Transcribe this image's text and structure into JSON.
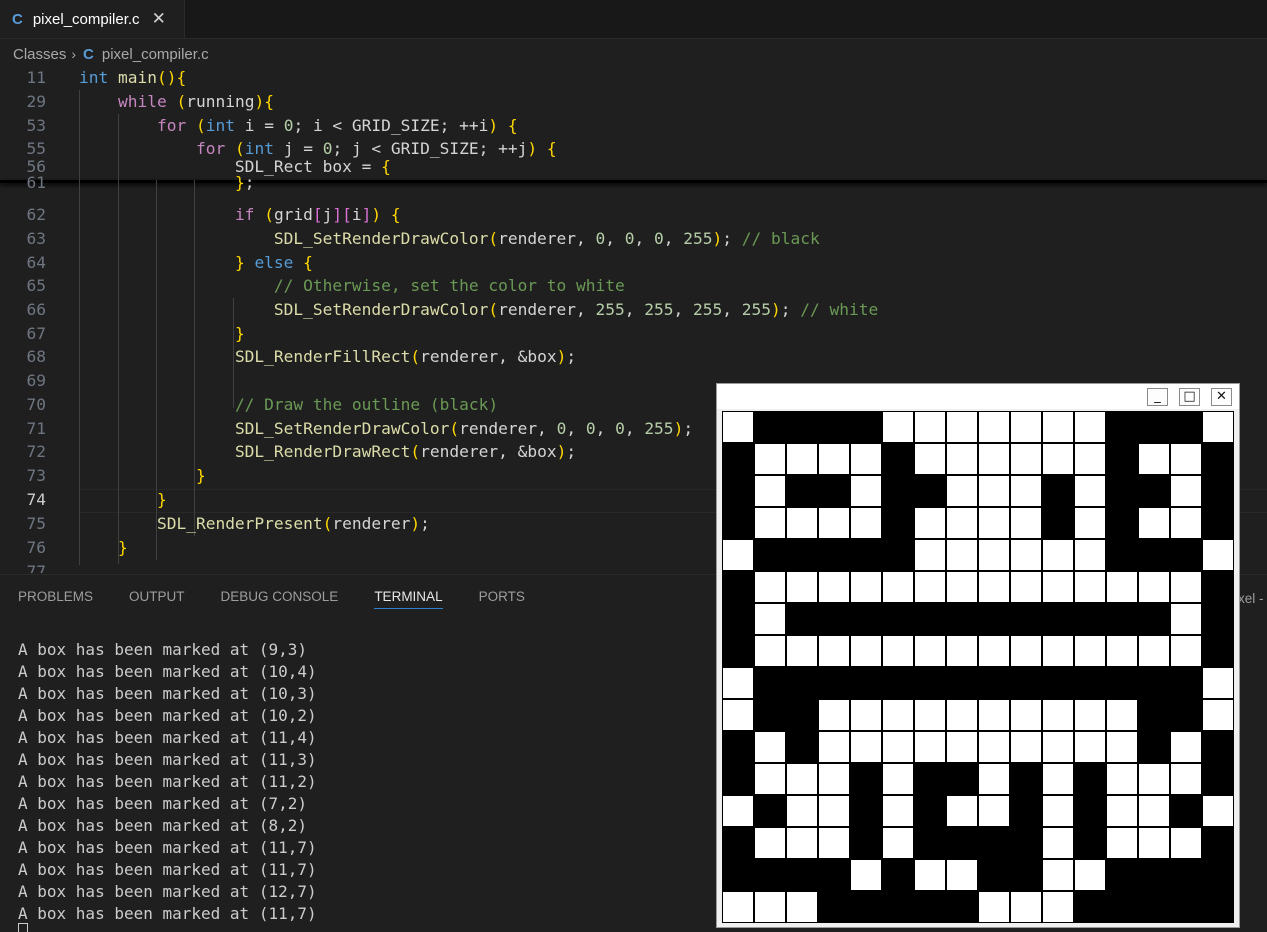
{
  "tab": {
    "icon": "c-file-icon",
    "icon_text": "C",
    "filename": "pixel_compiler.c",
    "close": "✕"
  },
  "breadcrumb": {
    "folder": "Classes",
    "sep": "›",
    "icon_text": "C",
    "file": "pixel_compiler.c"
  },
  "editor": {
    "active_line": "74",
    "lines": [
      {
        "n": "11",
        "code": "int main(){"
      },
      {
        "n": "29",
        "code": "    while (running){"
      },
      {
        "n": "53",
        "code": "        for (int i = 0; i < GRID_SIZE; ++i) {"
      },
      {
        "n": "55",
        "code": "            for (int j = 0; j < GRID_SIZE; ++j) {"
      },
      {
        "n": "56",
        "code": "                SDL_Rect box = {"
      },
      {
        "n": "61",
        "code": "                };"
      },
      {
        "n": "62",
        "code": "                if (grid[j][i]) {"
      },
      {
        "n": "63",
        "code": "                    SDL_SetRenderDrawColor(renderer, 0, 0, 0, 255); // black"
      },
      {
        "n": "64",
        "code": "                } else {"
      },
      {
        "n": "65",
        "code": "                    // Otherwise, set the color to white"
      },
      {
        "n": "66",
        "code": "                    SDL_SetRenderDrawColor(renderer, 255, 255, 255, 255); // white"
      },
      {
        "n": "67",
        "code": "                }"
      },
      {
        "n": "68",
        "code": "                SDL_RenderFillRect(renderer, &box);"
      },
      {
        "n": "69",
        "code": ""
      },
      {
        "n": "70",
        "code": "                // Draw the outline (black)"
      },
      {
        "n": "71",
        "code": "                SDL_SetRenderDrawColor(renderer, 0, 0, 0, 255);"
      },
      {
        "n": "72",
        "code": "                SDL_RenderDrawRect(renderer, &box);"
      },
      {
        "n": "73",
        "code": "            }"
      },
      {
        "n": "74",
        "code": "        }"
      },
      {
        "n": "75",
        "code": "        SDL_RenderPresent(renderer);"
      },
      {
        "n": "76",
        "code": "    }"
      },
      {
        "n": "77",
        "code": ""
      }
    ]
  },
  "panel": {
    "tabs": [
      "PROBLEMS",
      "OUTPUT",
      "DEBUG CONSOLE",
      "TERMINAL",
      "PORTS"
    ],
    "active_tab": "TERMINAL",
    "right_partial": "xel -",
    "terminal_lines": [
      "A box has been marked at (9,3)",
      "A box has been marked at (10,4)",
      "A box has been marked at (10,3)",
      "A box has been marked at (10,2)",
      "A box has been marked at (11,4)",
      "A box has been marked at (11,3)",
      "A box has been marked at (11,2)",
      "A box has been marked at (7,2)",
      "A box has been marked at (8,2)",
      "A box has been marked at (11,7)",
      "A box has been marked at (11,7)",
      "A box has been marked at (12,7)",
      "A box has been marked at (11,7)"
    ]
  },
  "sdl_window": {
    "buttons": {
      "minimize": "_",
      "maximize": "□",
      "close": "✕"
    },
    "grid_size": 16,
    "grid_rows": [
      "0111100000001110",
      "1000010000001001",
      "1011011000101101",
      "1000010000101001",
      "0111110000001110",
      "1000000000000001",
      "1011111111111101",
      "1000000000000001",
      "0111111111111110",
      "0110000000000110",
      "1010000000000101",
      "1000101101010001",
      "0100101001010010",
      "1000101111010001",
      "1111010011001111",
      "0001111100011111"
    ]
  },
  "colors": {
    "editor_bg": "#1f1f1f",
    "keyword": "#569cd6",
    "control": "#c586c0",
    "function": "#dcdcaa",
    "number": "#b5cea8",
    "comment": "#6a9955",
    "accent": "#2f80ce"
  }
}
